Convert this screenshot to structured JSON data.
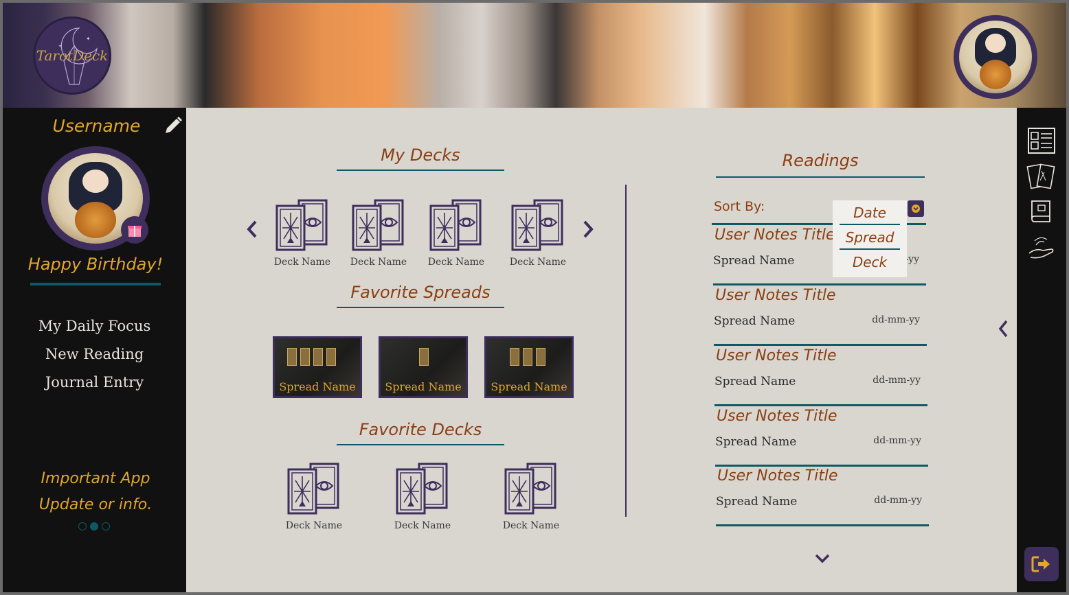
{
  "app": {
    "logo_text": "TarotDeck",
    "username": "Username",
    "birthday_message": "Happy Birthday!",
    "nav": [
      "My Daily Focus",
      "New Reading",
      "Journal Entry"
    ],
    "info": {
      "line1": "Important App",
      "line2": "Update or info."
    },
    "carousel_dots": 3,
    "carousel_active": 2
  },
  "my_decks": {
    "title": "My Decks",
    "items": [
      "Deck Name",
      "Deck Name",
      "Deck Name",
      "Deck Name"
    ]
  },
  "favorite_spreads": {
    "title": "Favorite Spreads",
    "items": [
      "Spread Name",
      "Spread Name",
      "Spread Name"
    ]
  },
  "favorite_decks": {
    "title": "Favorite Decks",
    "items": [
      "Deck Name",
      "Deck Name",
      "Deck Name"
    ]
  },
  "readings": {
    "title": "Readings",
    "sort_label": "Sort By:",
    "sort_options": [
      "Date",
      "Spread",
      "Deck"
    ],
    "items": [
      {
        "title": "User Notes Title",
        "spread": "Spread Name",
        "date": "dd-mm-yy"
      },
      {
        "title": "User Notes Title",
        "spread": "Spread Name",
        "date": "dd-mm-yy"
      },
      {
        "title": "User Notes Title",
        "spread": "Spread Name",
        "date": "dd-mm-yy"
      },
      {
        "title": "User Notes Title",
        "spread": "Spread Name",
        "date": "dd-mm-yy"
      },
      {
        "title": "User Notes Title",
        "spread": "Spread Name",
        "date": "dd-mm-yy"
      }
    ]
  },
  "icons": {
    "edit": "pencil-icon",
    "gift": "gift-icon",
    "prev": "chevron-left-icon",
    "next": "chevron-right-icon",
    "sort_toggle": "chevron-down-icon",
    "collapse": "chevron-left-icon",
    "more": "chevron-down-icon",
    "rail": [
      "layout-icon",
      "cards-icon",
      "journal-book-icon",
      "hand-icon"
    ],
    "logout": "logout-icon"
  },
  "colors": {
    "accent_gold": "#e2a628",
    "accent_rust": "#8a3f12",
    "purple": "#3d2e5c",
    "teal": "#0e5a64",
    "panel": "#d9d6d0"
  }
}
